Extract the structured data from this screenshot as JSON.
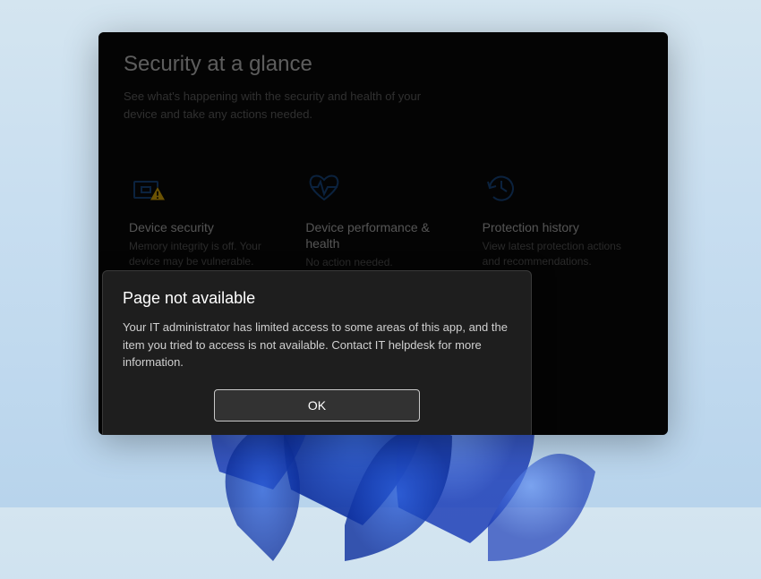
{
  "header": {
    "title": "Security at a glance",
    "subtitle": "See what's happening with the security and health of your device and take any actions needed."
  },
  "cards": [
    {
      "icon": "device-security-icon",
      "title": "Device security",
      "desc": "Memory integrity is off. Your device may be vulnerable.",
      "status": "warning"
    },
    {
      "icon": "heart-activity-icon",
      "title": "Device performance & health",
      "desc": "No action needed.",
      "status": "ok"
    },
    {
      "icon": "history-icon",
      "title": "Protection history",
      "desc": "View latest protection actions and recommendations.",
      "status": "ok"
    }
  ],
  "dialog": {
    "title": "Page not available",
    "body": "Your IT administrator has limited access to some areas of this app, and the item you tried to access is not available. Contact IT helpdesk for more information.",
    "ok_label": "OK"
  },
  "colors": {
    "accent": "#1a4d8a",
    "warn": "#f0b90b"
  }
}
